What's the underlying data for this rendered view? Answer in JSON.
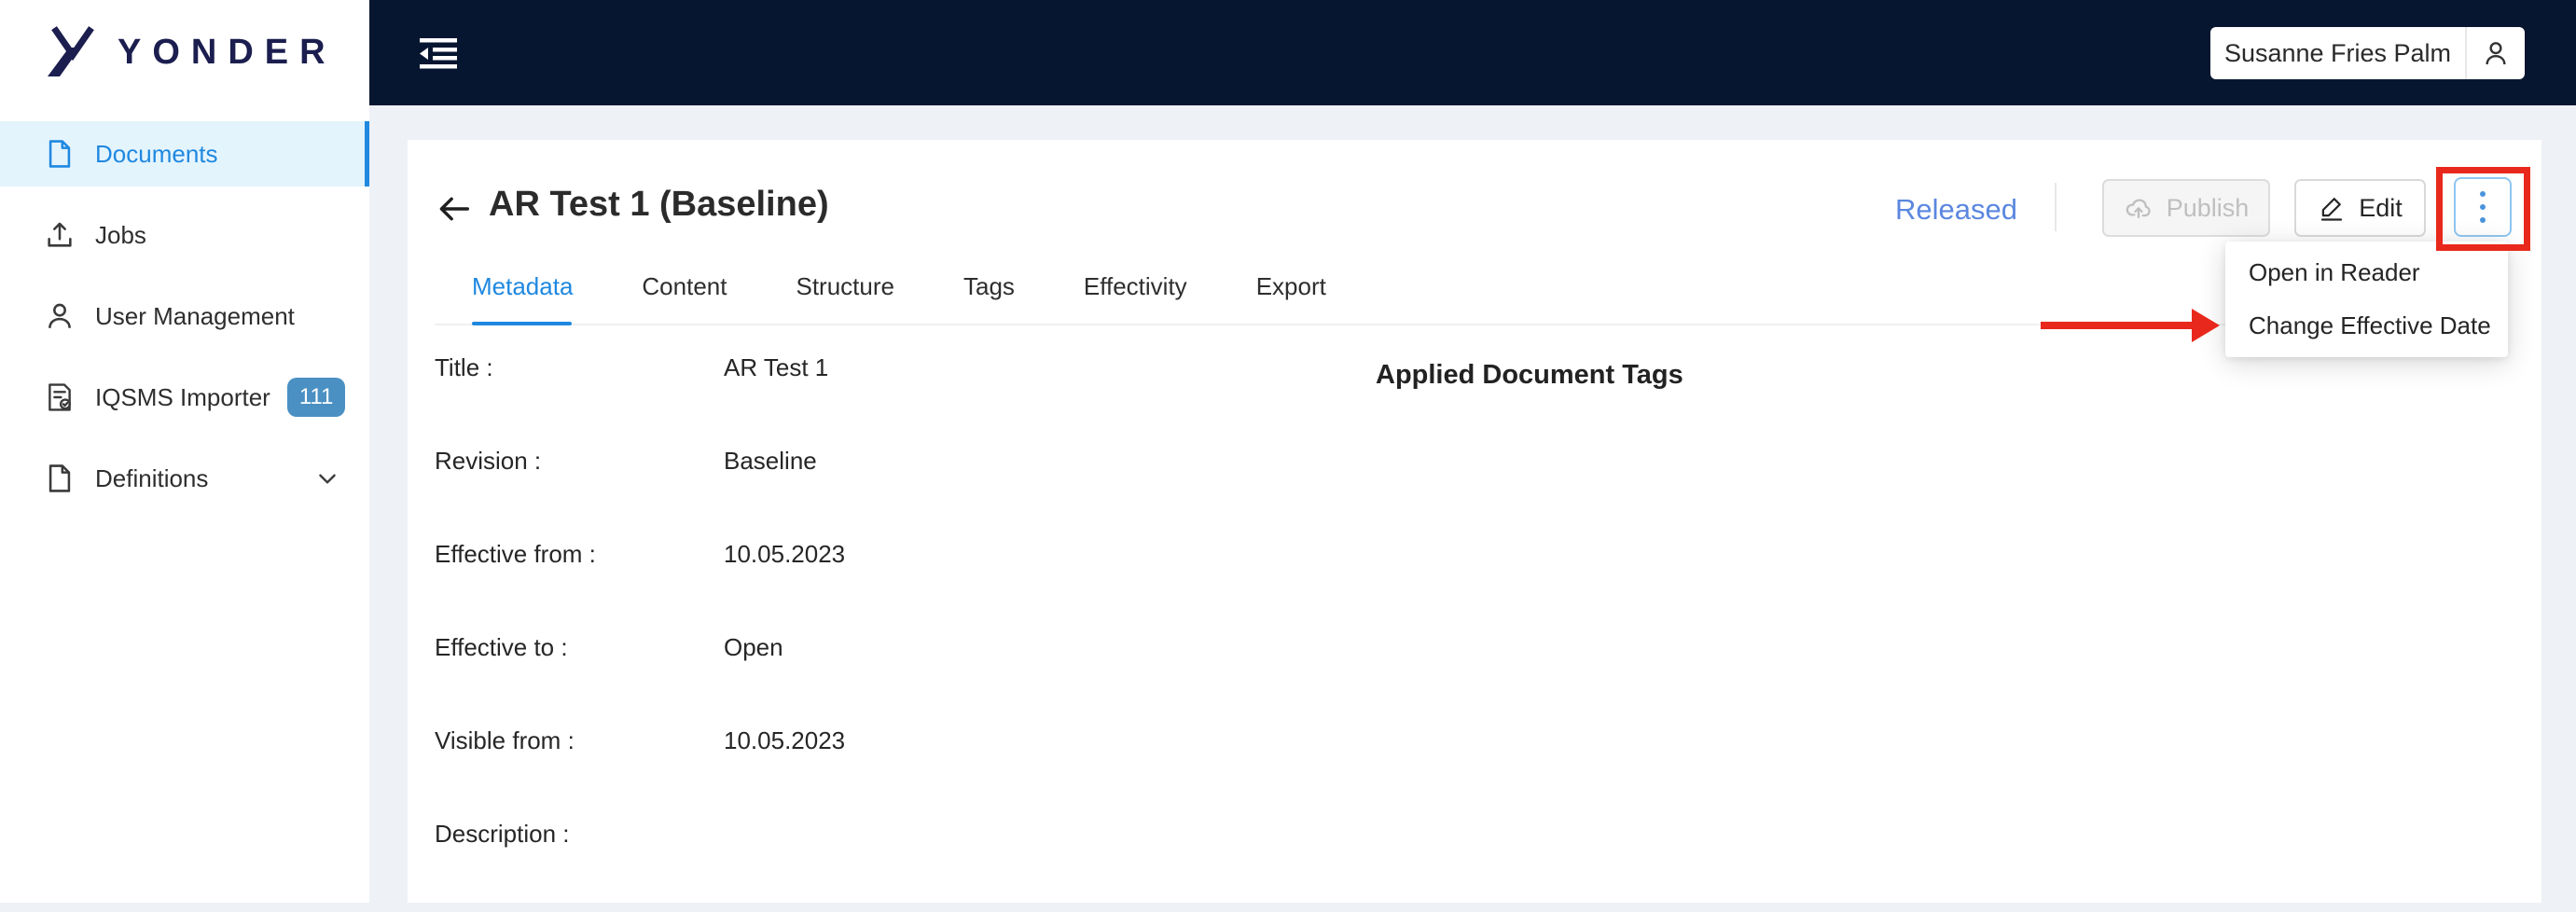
{
  "colors": {
    "topbar_bg": "#071630",
    "brand_navy": "#1b1e4e",
    "accent_blue": "#1f88e0",
    "sidebar_selected_bg": "#e4f4fd",
    "badge_blue": "#4a90c2",
    "status_released_blue": "#5b87e0",
    "disabled_text": "#bfbfbf",
    "annotation_red": "#e8281c"
  },
  "topbar": {
    "brand": "YONDER",
    "collapse_icon": "menu-fold-icon",
    "user_button": {
      "name": "Susanne Fries Palm",
      "icon": "person-icon"
    }
  },
  "sidebar": {
    "items": [
      {
        "label": "Documents",
        "icon": "file-icon",
        "active": true
      },
      {
        "label": "Jobs",
        "icon": "upload-icon"
      },
      {
        "label": "User Management",
        "icon": "person-icon"
      },
      {
        "label": "IQSMS Importer",
        "icon": "file-protect-icon",
        "badge": "111"
      },
      {
        "label": "Definitions",
        "icon": "file-icon",
        "chevron": "chevron-down-icon"
      }
    ]
  },
  "document": {
    "back_icon": "arrow-left-icon",
    "title": "AR Test 1 (Baseline)",
    "status": "Released",
    "actions": {
      "publish_label": "Publish",
      "publish_icon": "cloud-upload-icon",
      "publish_disabled": true,
      "edit_label": "Edit",
      "edit_icon": "edit-pen-icon",
      "more_icon": "kebab-vertical-dots-icon"
    },
    "tabs": [
      {
        "label": "Metadata",
        "active": true
      },
      {
        "label": "Content"
      },
      {
        "label": "Structure"
      },
      {
        "label": "Tags"
      },
      {
        "label": "Effectivity"
      },
      {
        "label": "Export"
      }
    ],
    "metadata_fields": [
      {
        "label": "Title :",
        "value": "AR Test 1"
      },
      {
        "label": "Revision :",
        "value": "Baseline"
      },
      {
        "label": "Effective from :",
        "value": "10.05.2023"
      },
      {
        "label": "Effective to :",
        "value": "Open"
      },
      {
        "label": "Visible from :",
        "value": "10.05.2023"
      },
      {
        "label": "Description :",
        "value": ""
      }
    ],
    "tags_heading": "Applied Document Tags"
  },
  "dropdown": {
    "items": [
      "Open in Reader",
      "Change Effective Date"
    ]
  },
  "annotations": {
    "highlight_box_target": "more-actions-button",
    "arrow_target": "Change Effective Date"
  }
}
